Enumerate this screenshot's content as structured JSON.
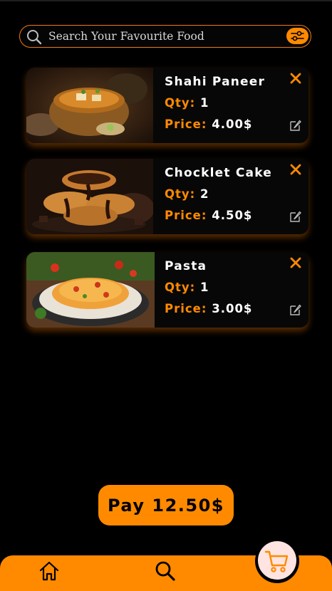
{
  "search": {
    "placeholder": "Search Your Favourite Food"
  },
  "cart": {
    "items": [
      {
        "name": "Shahi Paneer",
        "qty_label": "Qty:",
        "qty": "1",
        "price_label": "Price:",
        "price": "4.00$"
      },
      {
        "name": "Chocklet Cake",
        "qty_label": "Qty:",
        "qty": "2",
        "price_label": "Price:",
        "price": "4.50$"
      },
      {
        "name": "Pasta",
        "qty_label": "Qty:",
        "qty": "1",
        "price_label": "Price:",
        "price": "3.00$"
      }
    ]
  },
  "pay": {
    "label": "Pay 12.50$"
  },
  "icons": {
    "search": "search-icon",
    "filter": "sliders-icon",
    "remove": "close-icon",
    "edit": "edit-icon",
    "home": "home-icon",
    "nav_search": "search-icon",
    "cart": "cart-icon"
  },
  "colors": {
    "accent": "#ff8a00",
    "background": "#000000",
    "cart_bubble": "#ffe4e1"
  }
}
